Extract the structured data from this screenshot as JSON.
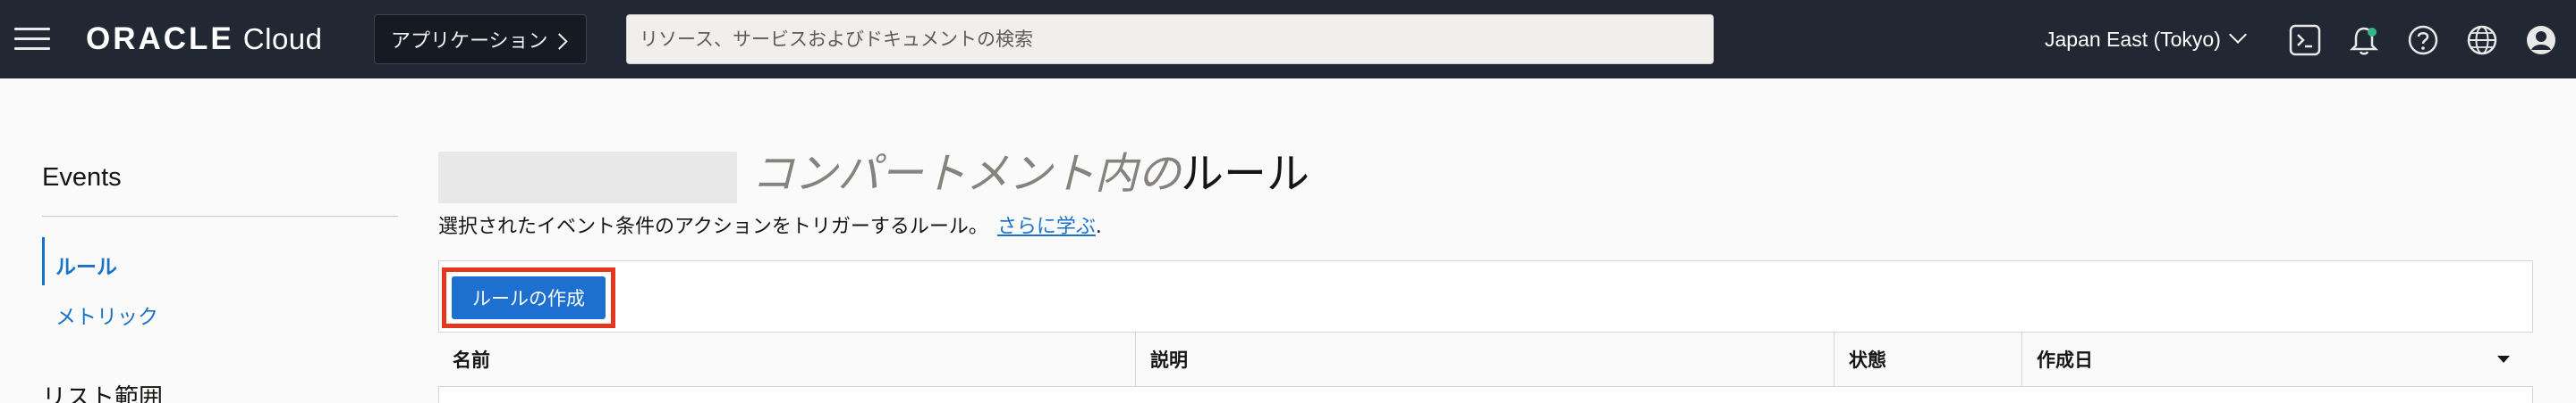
{
  "topbar": {
    "brand_oracle": "ORACLE",
    "brand_cloud": "Cloud",
    "apps_label": "アプリケーション",
    "search_placeholder": "リソース、サービスおよびドキュメントの検索",
    "region": "Japan East (Tokyo)",
    "icons": [
      "menu-icon",
      "chevron-right-icon",
      "chevron-down-icon",
      "cloud-shell-icon",
      "bell-icon",
      "help-icon",
      "globe-icon",
      "user-profile-icon"
    ],
    "notification_dot_color": "#35b58a"
  },
  "sidebar": {
    "title": "Events",
    "items": [
      {
        "label": "ルール",
        "active": true
      },
      {
        "label": "メトリック",
        "active": false
      }
    ],
    "section_title": "リスト範囲"
  },
  "main": {
    "title_prefix": "コンパートメント内の",
    "title_main": "ルール",
    "subtitle": "選択されたイベント条件のアクションをトリガーするルール。",
    "learn_more": "さらに学ぶ",
    "learn_more_suffix": ".",
    "create_button": "ルールの作成",
    "table_headers": [
      "名前",
      "説明",
      "状態",
      "作成日"
    ],
    "sorted_column": "作成日"
  },
  "colors": {
    "topbar_bg": "#212833",
    "accent": "#1a73c8",
    "primary_button": "#1d6fd0",
    "highlight_border": "#e5371f"
  }
}
